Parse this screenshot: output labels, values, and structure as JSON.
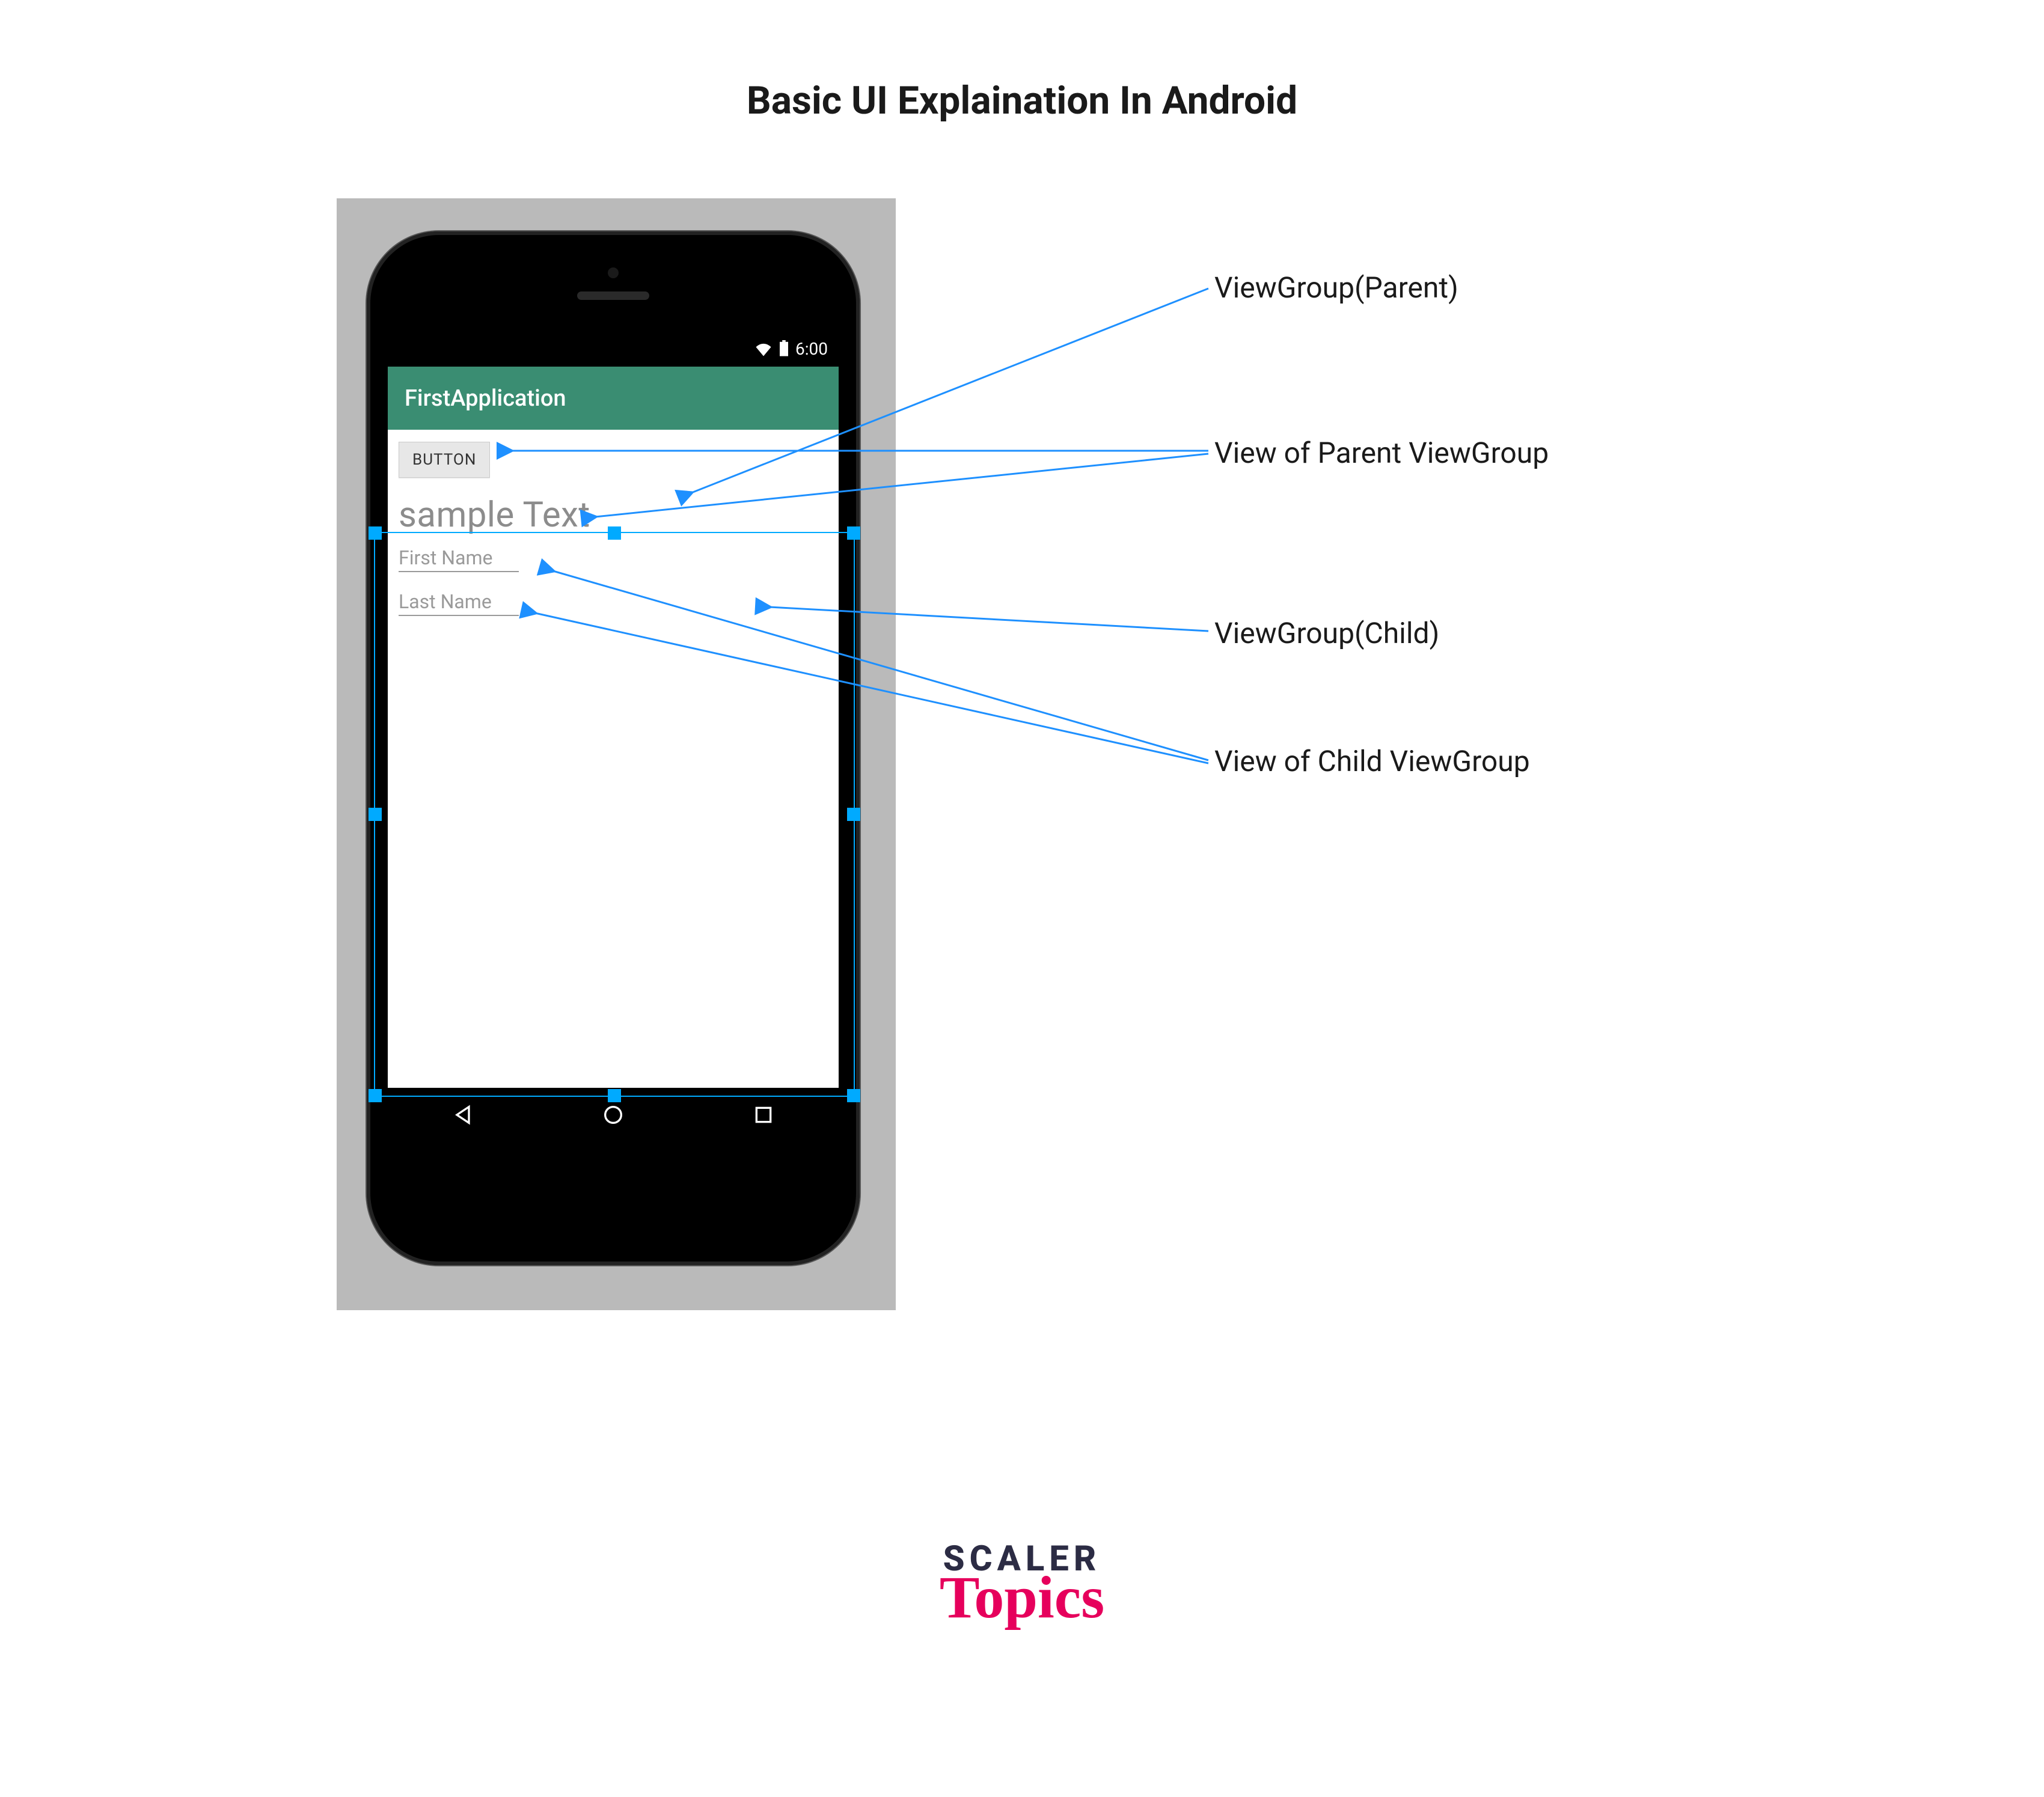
{
  "title": "Basic UI Explaination In Android",
  "phone": {
    "status": {
      "time": "6:00"
    },
    "appbar": {
      "title": "FirstApplication"
    },
    "content": {
      "button_label": "BUTTON",
      "sample_text": "sample Text",
      "input1": "First Name",
      "input2": "Last Name"
    }
  },
  "labels": {
    "parent_group": "ViewGroup(Parent)",
    "parent_view": "View of Parent ViewGroup",
    "child_group": "ViewGroup(Child)",
    "child_view": "View of Child ViewGroup"
  },
  "logo": {
    "top": "SCALER",
    "bottom": "Topics"
  }
}
